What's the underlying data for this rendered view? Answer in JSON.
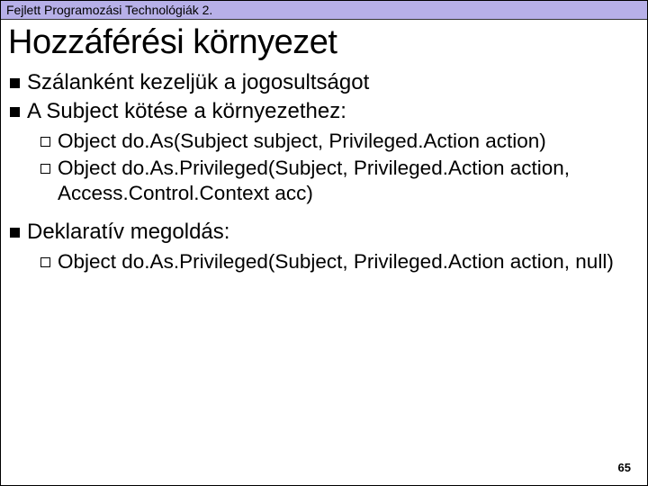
{
  "header": {
    "course": "Fejlett Programozási Technológiák 2."
  },
  "title": "Hozzáférési környezet",
  "bullets": {
    "b1": "Szálanként kezeljük a jogosultságot",
    "b2": "A Subject kötése a környezethez:",
    "b2a": "Object do.As(Subject subject, Privileged.Action action)",
    "b2b": "Object do.As.Privileged(Subject, Privileged.Action action, Access.Control.Context acc)",
    "b3": "Deklaratív megoldás:",
    "b3a": "Object do.As.Privileged(Subject, Privileged.Action action, null)"
  },
  "page_number": "65"
}
